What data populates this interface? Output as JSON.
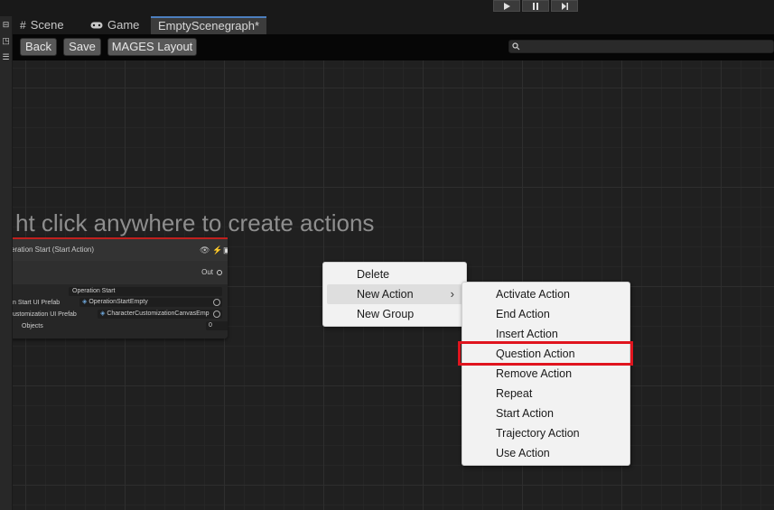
{
  "playbar": {
    "buttons": [
      "play-icon",
      "pause-icon",
      "step-icon"
    ]
  },
  "tabs": [
    {
      "icon": "grid-icon",
      "label": "Scene"
    },
    {
      "icon": "gamepad-icon",
      "label": "Game"
    },
    {
      "label": "EmptyScenegraph*"
    }
  ],
  "toolbar": {
    "back_label": "Back",
    "save_label": "Save",
    "layout_label": "MAGES Layout",
    "search_placeholder": ""
  },
  "graph": {
    "hint": "ht click anywhere to create actions",
    "node": {
      "title": "eration Start (Start Action)",
      "out_label": "Out",
      "section_label": "Operation Start",
      "rows": [
        {
          "label": "n Start UI Prefab",
          "value": "OperationStartEmpty"
        },
        {
          "label": "ustomization UI Prefab",
          "value": "CharacterCustomizationCanvasEmp"
        },
        {
          "label": "Objects",
          "value": "0"
        }
      ]
    }
  },
  "context_menu": {
    "items": [
      "Delete",
      "New Action",
      "New Group"
    ],
    "hovered": "New Action"
  },
  "submenu": {
    "items": [
      "Activate Action",
      "End Action",
      "Insert Action",
      "Question Action",
      "Remove Action",
      "Repeat",
      "Start Action",
      "Trajectory Action",
      "Use Action"
    ],
    "highlighted": "Question Action",
    "highlight_color": "#e0141e"
  }
}
